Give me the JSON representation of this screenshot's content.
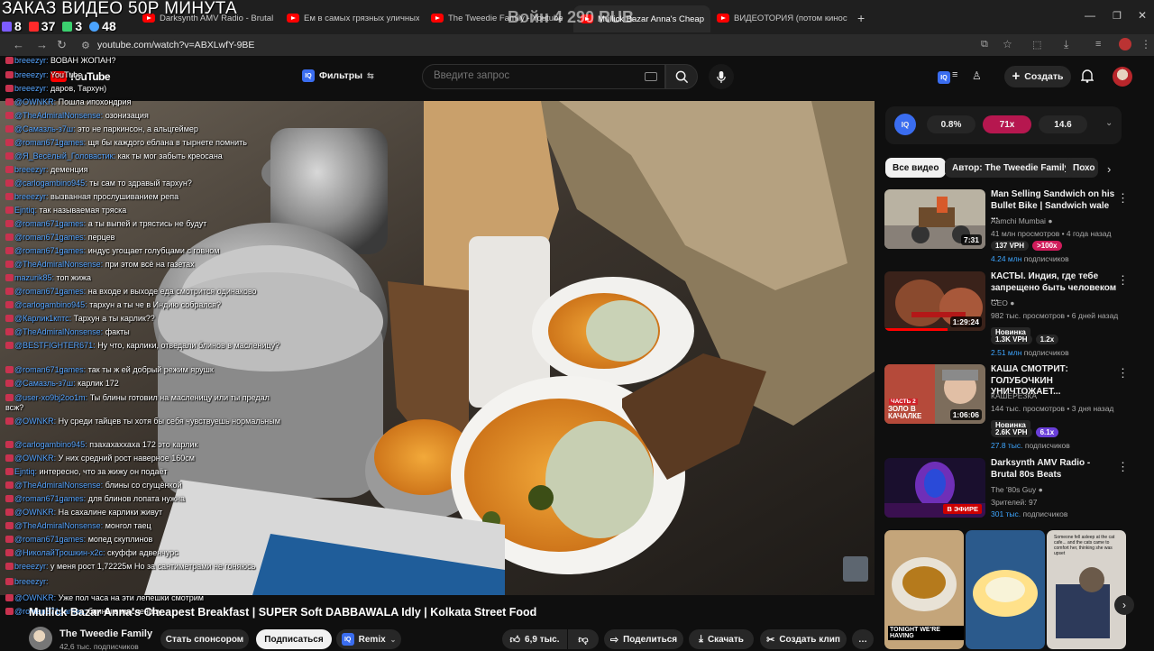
{
  "browser": {
    "tabs": [
      {
        "label": "Darksynth AMV Radio - Brutal 8"
      },
      {
        "label": "Ем в самых грязных уличных"
      },
      {
        "label": "The Tweedie Family - Youtube"
      },
      {
        "label": "Mullick Bazar Anna's Cheap"
      },
      {
        "label": "ВИДЕОТОРИЯ (потом кинострим"
      }
    ],
    "url": "youtube.com/watch?v=ABXLwfY-9BE"
  },
  "overlay": {
    "title": "ЗАКАЗ ВИДЕО 50Р МИНУТА",
    "amount": "Войн 4 290 RUB",
    "stats": [
      {
        "value": "8",
        "color": "#7c5cff"
      },
      {
        "value": "37",
        "color": "#ff2a2a"
      },
      {
        "value": "3",
        "color": "#3bd16f"
      },
      {
        "value": "48",
        "color": "#4aa3ff"
      }
    ]
  },
  "header": {
    "logo_text": "YouTube",
    "filters_label": "Фильтры",
    "search_placeholder": "Введите запрос",
    "create_label": "Создать"
  },
  "chat": [
    {
      "user": "breeezyr:",
      "text": "ВОВАН ЖОПАН?"
    },
    {
      "user": "breeezyr:",
      "text": "YouTube"
    },
    {
      "user": "breeezyr:",
      "text": "даров, Тархун)"
    },
    {
      "user": "@OWNKR:",
      "text": "Пошла ипохондрия"
    },
    {
      "user": "@TheAdmiralNonsense:",
      "text": "озонизация"
    },
    {
      "user": "@Самазль-з7ш:",
      "text": "это не паркинсон, а альцгеймер"
    },
    {
      "user": "@roman671games:",
      "text": "щя бы каждого еблана в тырнете помнить"
    },
    {
      "user": "@Я_Весёлый_Головастик:",
      "text": "как ты мог забыть креосана"
    },
    {
      "user": "breeezyr:",
      "text": "деменция"
    },
    {
      "user": "@carlogambino945:",
      "text": "ты сам то здравый тархун?"
    },
    {
      "user": "breeezyr:",
      "text": "вызванная прослушиванием репа"
    },
    {
      "user": "Ejntiq:",
      "text": "так называемая тряска"
    },
    {
      "user": "@roman671games:",
      "text": "а ты выпей и трястись не будут"
    },
    {
      "user": "@roman671games:",
      "text": "перцев"
    },
    {
      "user": "@roman671games:",
      "text": "индус угощает голубцами с говном"
    },
    {
      "user": "@TheAdmiralNonsense:",
      "text": "при этом всё на газетах"
    },
    {
      "user": "mazurik85:",
      "text": "топ жижа"
    },
    {
      "user": "@roman671games:",
      "text": "на входе и выходе еда смотрится одинаково"
    },
    {
      "user": "@carlogambino945:",
      "text": "тархун а ты че в Индию собрался?"
    },
    {
      "user": "@Карлик1кптс:",
      "text": "Тархун а ты карлик??"
    },
    {
      "user": "@TheAdmiralNonsense:",
      "text": "факты"
    },
    {
      "user": "@BESTFIGHTER671:",
      "text": "Ну что, карлики, отведали блинов в масленицу?"
    },
    {
      "user": "@roman671games:",
      "text": "так ты ж ей добрый режим ярушк"
    },
    {
      "user": "@Самазль-з7ш:",
      "text": "карлик 172"
    },
    {
      "user": "@user-xo9bj2oo1m:",
      "text": "Ты блины готовил на масленицу или ты предал всж?"
    },
    {
      "user": "@OWNKR:",
      "text": "Ну среди тайцев ты хотя бы себя чувствуешь нормальным"
    },
    {
      "user": "@carlogambino945:",
      "text": "пзахахаххаха 172 это карлик"
    },
    {
      "user": "@OWNKR:",
      "text": "У них средний рост наверное 160см"
    },
    {
      "user": "Ejntiq:",
      "text": "интересно, что за жижу он подаёт"
    },
    {
      "user": "@TheAdmiralNonsense:",
      "text": "блины со сгущёнкой"
    },
    {
      "user": "@roman671games:",
      "text": "для блинов лопата нужна"
    },
    {
      "user": "@OWNKR:",
      "text": "На сахалине карлики живут"
    },
    {
      "user": "@TheAdmiralNonsense:",
      "text": "монгол таец"
    },
    {
      "user": "@roman671games:",
      "text": "мопед скуплинов"
    },
    {
      "user": "@НиколайТрошкин-х2с:",
      "text": "скуффи адвенчурс"
    },
    {
      "user": "breeezyr:",
      "text": "у меня рост 1,72225м Но за сантиметрами не гоняюсь"
    },
    {
      "user": "breeezyr:",
      "text": ""
    },
    {
      "user": "@OWNKR:",
      "text": "Уже пол часа на эти лепешки смотрим"
    },
    {
      "user": "@roman671games:",
      "text": "блины в масленицу"
    }
  ],
  "video": {
    "title": "Mullick Bazar Anna's Cheapest Breakfast | SUPER Soft DABBAWALA Idly | Kolkata Street Food"
  },
  "channel": {
    "name": "The Tweedie Family",
    "subscribers": "42,6 тыс. подписчиков",
    "sponsor_label": "Стать спонсором",
    "subscribe_label": "Подписаться",
    "remix_label": "Remix",
    "likes": "6,9 тыс.",
    "share_label": "Поделиться",
    "download_label": "Скачать",
    "clip_label": "Создать клип"
  },
  "iq_panel": {
    "values": [
      "0.8%",
      "71x",
      "14.6"
    ]
  },
  "chips": [
    "Все видео",
    "Автор: The Tweedie Family",
    "Похо"
  ],
  "recommendations": [
    {
      "title": "Man Selling Sandwich on his Bullet Bike | Sandwich wale ...",
      "channel": "Aamchi Mumbai",
      "meta": "41 млн просмотров • 4 года назад",
      "duration": "7:31",
      "badges": [
        "137 VPH",
        ">100x"
      ],
      "subs": "4.24 млн",
      "subs_suffix": "подписчиков",
      "badge_colors": [
        "#272727",
        "#d01c5b"
      ]
    },
    {
      "title": "КАСТЫ. Индия, где тебе запрещено быть человеком ...",
      "channel": "GEO",
      "meta": "982 тыс. просмотров • 6 дней назад",
      "duration": "1:29:24",
      "new": "Новинка",
      "badges": [
        "1.3K VPH",
        "1.2x"
      ],
      "subs": "2.51 млн",
      "subs_suffix": "подписчиков",
      "badge_colors": [
        "#272727",
        "#272727"
      ]
    },
    {
      "title": "КАША СМОТРИТ: ГОЛУБОЧКИН УНИЧТОЖАЕТ...",
      "channel": "КАШЕРЕЗКА",
      "meta": "144 тыс. просмотров • 3 дня назад",
      "duration": "1:06:06",
      "new": "Новинка",
      "badges": [
        "2.6K VPH",
        "6.1x"
      ],
      "subs": "27.8 тыс.",
      "subs_suffix": "подписчиков",
      "badge_colors": [
        "#272727",
        "#6a3fd8"
      ]
    },
    {
      "title": "Darksynth AMV Radio - Brutal 80s Beats",
      "channel": "The '80s Guy",
      "meta": "Зрителей: 97",
      "live": "В ЭФИРЕ",
      "subs": "301 тыс.",
      "subs_suffix": "подписчиков"
    }
  ],
  "thumb_text": {
    "kasha_1": "ЧАСТЬ 2",
    "kasha_2": "ЗОЛО В КАЧАЛКЕ",
    "short_1": "TONIGHT WE'RE HAVING",
    "short_3": "Someone fell asleep at the cat cafe... and the cats came to comfort her, thinking she was upset"
  }
}
